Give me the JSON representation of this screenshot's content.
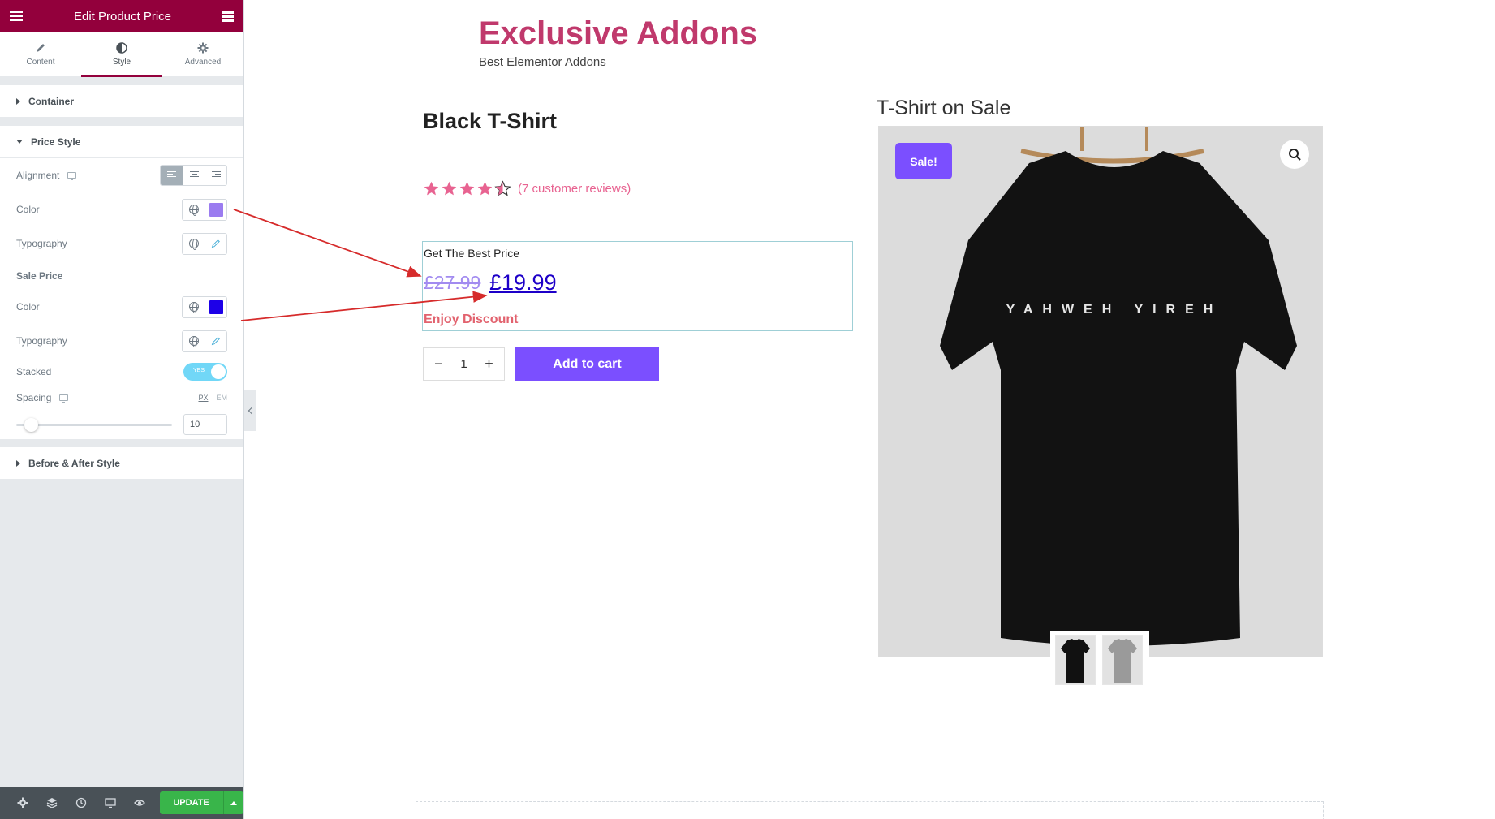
{
  "editor": {
    "header_title": "Edit Product Price",
    "tabs": [
      {
        "label": "Content"
      },
      {
        "label": "Style"
      },
      {
        "label": "Advanced"
      }
    ],
    "sections": {
      "container": "Container",
      "price_style": "Price Style",
      "before_after": "Before & After Style"
    },
    "price_style": {
      "alignment_label": "Alignment",
      "color_label": "Color",
      "color_value": "#9b7cf0",
      "typography_label": "Typography"
    },
    "sale_price": {
      "heading": "Sale Price",
      "color_label": "Color",
      "color_value": "#1d00e8",
      "typography_label": "Typography",
      "stacked_label": "Stacked",
      "stacked_toggle": "YES",
      "spacing_label": "Spacing",
      "unit_px": "PX",
      "unit_em": "EM",
      "spacing_value": "10"
    },
    "footer": {
      "update_label": "UPDATE"
    }
  },
  "site": {
    "title": "Exclusive Addons",
    "tagline": "Best Elementor Addons"
  },
  "product": {
    "title": "Black T-Shirt",
    "rating": 4.5,
    "reviews_text": "(7 customer reviews)",
    "price_label": "Get The Best Price",
    "old_price": "£27.99",
    "new_price": "£19.99",
    "discount_text": "Enjoy Discount",
    "quantity": "1",
    "qty_minus": "−",
    "qty_plus": "+",
    "add_to_cart": "Add to cart"
  },
  "gallery": {
    "title": "T-Shirt on Sale",
    "sale_badge": "Sale!",
    "shirt_print": "YAHWEH YIREH"
  },
  "colors": {
    "brand": "#93003c",
    "site_title": "#c0396c",
    "accent_button": "#7b4fff",
    "update_green": "#39b54a",
    "annotation_arrow": "#d62b2b"
  }
}
